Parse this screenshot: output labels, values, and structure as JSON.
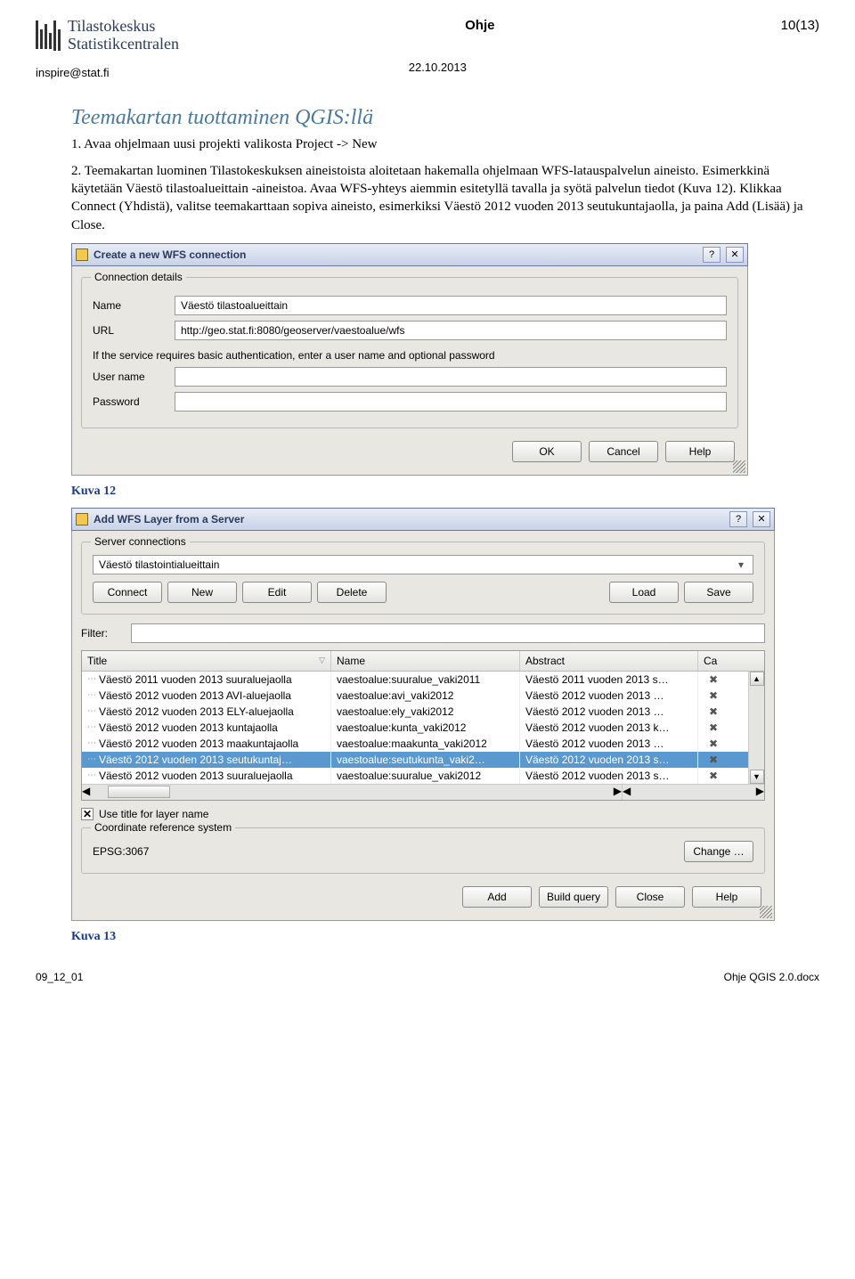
{
  "header": {
    "logo_line1": "Tilastokeskus",
    "logo_line2": "Statistikcentralen",
    "doc_type": "Ohje",
    "page": "10(13)",
    "email": "inspire@stat.fi",
    "date": "22.10.2013"
  },
  "section": {
    "title": "Teemakartan tuottaminen QGIS:llä",
    "p1": "1. Avaa ohjelmaan uusi projekti valikosta Project -> New",
    "p2": "2. Teemakartan luominen Tilastokeskuksen aineistoista aloitetaan hakemalla ohjelmaan WFS-latauspalvelun aineisto. Esimerkkinä käytetään Väestö tilastoalueittain -aineistoa. Avaa WFS-yhteys aiemmin esitetyllä tavalla ja syötä palvelun tiedot (Kuva 12). Klikkaa Connect (Yhdistä), valitse teemakarttaan sopiva aineisto, esimerkiksi Väestö 2012 vuoden 2013 seutukuntajaolla, ja paina Add (Lisää) ja Close."
  },
  "dlg1": {
    "title": "Create a new WFS connection",
    "group": "Connection details",
    "name_label": "Name",
    "name_value": "Väestö tilastoalueittain",
    "url_label": "URL",
    "url_value": "http://geo.stat.fi:8080/geoserver/vaestoalue/wfs",
    "auth_hint": "If the service requires basic authentication, enter a user name and optional password",
    "user_label": "User name",
    "pass_label": "Password",
    "ok": "OK",
    "cancel": "Cancel",
    "help": "Help"
  },
  "caption1": "Kuva 12",
  "dlg2": {
    "title": "Add WFS Layer from a Server",
    "group_conn": "Server connections",
    "dropdown_value": "Väestö tilastointialueittain",
    "btn_connect": "Connect",
    "btn_new": "New",
    "btn_edit": "Edit",
    "btn_delete": "Delete",
    "btn_load": "Load",
    "btn_save": "Save",
    "filter_label": "Filter:",
    "col_title": "Title",
    "col_name": "Name",
    "col_abstract": "Abstract",
    "col_ca": "Ca",
    "rows": [
      {
        "title": "Väestö 2011 vuoden 2013 suuraluejaolla",
        "name": "vaestoalue:suuralue_vaki2011",
        "abs": "Väestö 2011 vuoden 2013 s…",
        "sel": false
      },
      {
        "title": "Väestö 2012 vuoden 2013 AVI-aluejaolla",
        "name": "vaestoalue:avi_vaki2012",
        "abs": "Väestö 2012 vuoden 2013 …",
        "sel": false
      },
      {
        "title": "Väestö 2012 vuoden 2013 ELY-aluejaolla",
        "name": "vaestoalue:ely_vaki2012",
        "abs": "Väestö 2012 vuoden 2013 …",
        "sel": false
      },
      {
        "title": "Väestö 2012 vuoden 2013 kuntajaolla",
        "name": "vaestoalue:kunta_vaki2012",
        "abs": "Väestö 2012 vuoden 2013 k…",
        "sel": false
      },
      {
        "title": "Väestö 2012 vuoden 2013 maakuntajaolla",
        "name": "vaestoalue:maakunta_vaki2012",
        "abs": "Väestö 2012 vuoden 2013 …",
        "sel": false
      },
      {
        "title": "Väestö 2012 vuoden 2013 seutukuntaj…",
        "name": "vaestoalue:seutukunta_vaki2…",
        "abs": "Väestö 2012 vuoden 2013 s…",
        "sel": true
      },
      {
        "title": "Väestö 2012 vuoden 2013 suuraluejaolla",
        "name": "vaestoalue:suuralue_vaki2012",
        "abs": "Väestö 2012 vuoden 2013 s…",
        "sel": false
      }
    ],
    "use_title_label": "Use title for layer name",
    "group_crs": "Coordinate reference system",
    "crs_value": "EPSG:3067",
    "btn_change": "Change …",
    "btn_add": "Add",
    "btn_build": "Build query",
    "btn_close": "Close",
    "btn_help": "Help"
  },
  "caption2": "Kuva 13",
  "footer": {
    "left": "09_12_01",
    "right": "Ohje QGIS 2.0.docx"
  }
}
